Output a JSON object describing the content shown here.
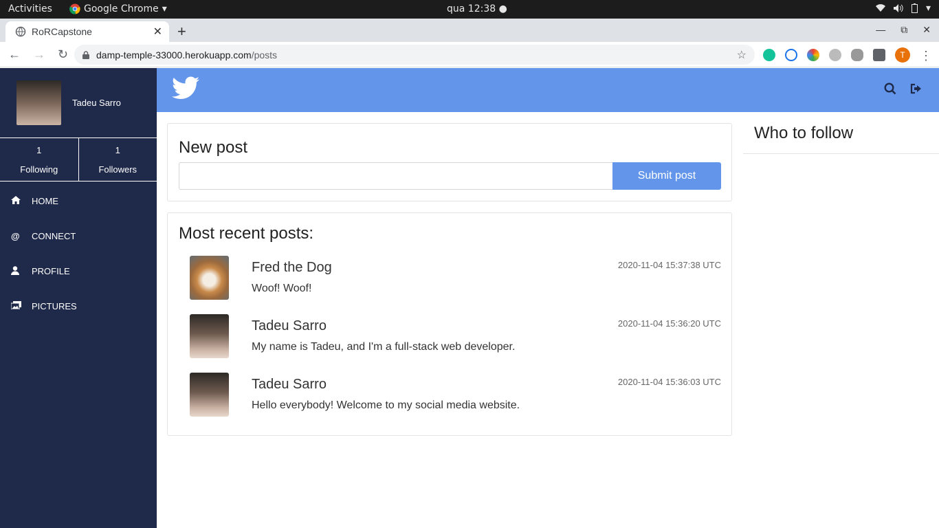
{
  "os": {
    "activities": "Activities",
    "app_name": "Google Chrome",
    "clock": "qua 12:38"
  },
  "browser": {
    "tab_title": "RoRCapstone",
    "url_host": "damp-temple-33000.herokuapp.com",
    "url_path": "/posts",
    "profile_initial": "T"
  },
  "sidebar": {
    "user_name": "Tadeu Sarro",
    "following_count": "1",
    "following_label": "Following",
    "followers_count": "1",
    "followers_label": "Followers",
    "items": [
      {
        "label": "HOME",
        "icon": "home-icon"
      },
      {
        "label": "CONNECT",
        "icon": "at-icon"
      },
      {
        "label": "PROFILE",
        "icon": "user-icon"
      },
      {
        "label": "PICTURES",
        "icon": "images-icon"
      }
    ]
  },
  "navbar": {
    "accent": "#6396eb"
  },
  "new_post": {
    "title": "New post",
    "input_value": "",
    "submit_label": "Submit post"
  },
  "recent": {
    "title": "Most recent posts:",
    "posts": [
      {
        "author": "Fred the Dog",
        "time": "2020-11-04 15:37:38 UTC",
        "text": "Woof! Woof!"
      },
      {
        "author": "Tadeu Sarro",
        "time": "2020-11-04 15:36:20 UTC",
        "text": "My name is Tadeu, and I'm a full-stack web developer."
      },
      {
        "author": "Tadeu Sarro",
        "time": "2020-11-04 15:36:03 UTC",
        "text": "Hello everybody! Welcome to my social media website."
      }
    ]
  },
  "who_to_follow": {
    "title": "Who to follow"
  }
}
